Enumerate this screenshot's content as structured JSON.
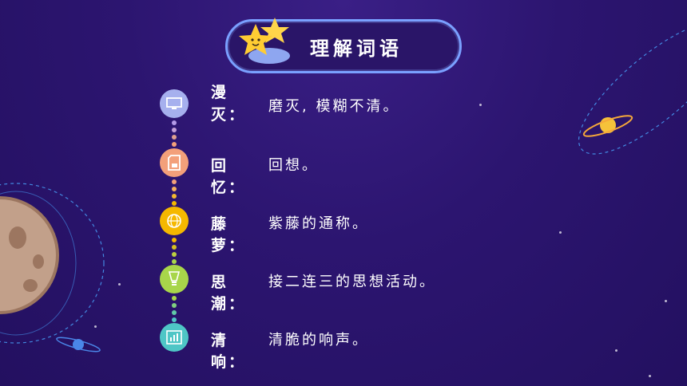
{
  "title": "理解词语",
  "colors": {
    "bg": "#2c1570",
    "accent": "#7aa0ff"
  },
  "items": [
    {
      "term": "漫灭：",
      "definition": "磨灭, 模糊不清。",
      "icon": "monitor-icon",
      "color": "#a6b0ee"
    },
    {
      "term": "回忆：",
      "definition": "回想。",
      "icon": "sd-card-icon",
      "color": "#f3a07a"
    },
    {
      "term": "藤萝：",
      "definition": "紫藤的通称。",
      "icon": "globe-icon",
      "color": "#f5b800"
    },
    {
      "term": "思潮：",
      "definition": "接二连三的思想活动。",
      "icon": "bulb-icon",
      "color": "#a8d64a"
    },
    {
      "term": "清响：",
      "definition": "清脆的响声。",
      "icon": "chart-icon",
      "color": "#4ec6c6"
    }
  ]
}
